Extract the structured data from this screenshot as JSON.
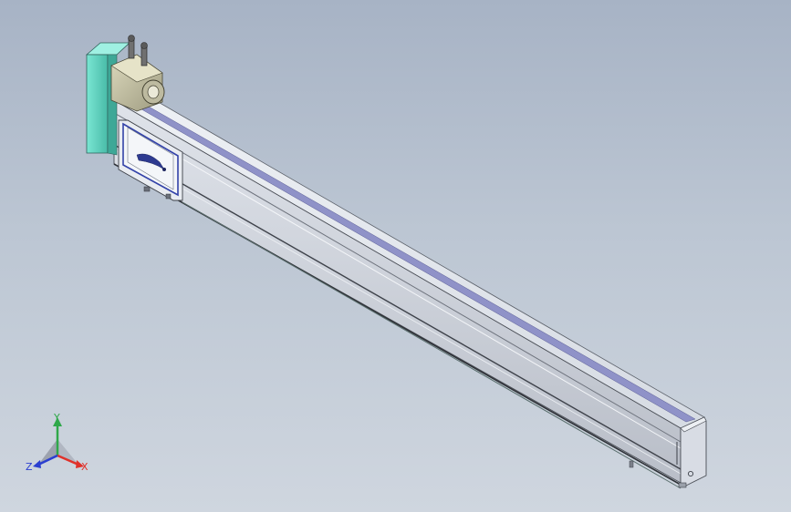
{
  "viewport": {
    "background_top": "#a7b3c5",
    "background_bottom": "#cfd6df"
  },
  "model": {
    "description_icon": "linear-actuator-model",
    "colors": {
      "rail_light": "#e4e8ee",
      "rail_mid": "#c8cdd6",
      "rail_dark": "#8b909a",
      "rail_edge": "#4a4e56",
      "slot_blue": "#8f92c8",
      "end_plate": "#d8dce4",
      "motor_housing": "#5fd3c0",
      "motor_body": "#c9c6a8",
      "carriage_blue": "#3342a8",
      "carriage_face": "#e9ecf1"
    }
  },
  "triad": {
    "x_label": "X",
    "y_label": "Y",
    "z_label": "Z",
    "x_color": "#e0312a",
    "y_color": "#2fa84a",
    "z_color": "#2b3fd0"
  }
}
